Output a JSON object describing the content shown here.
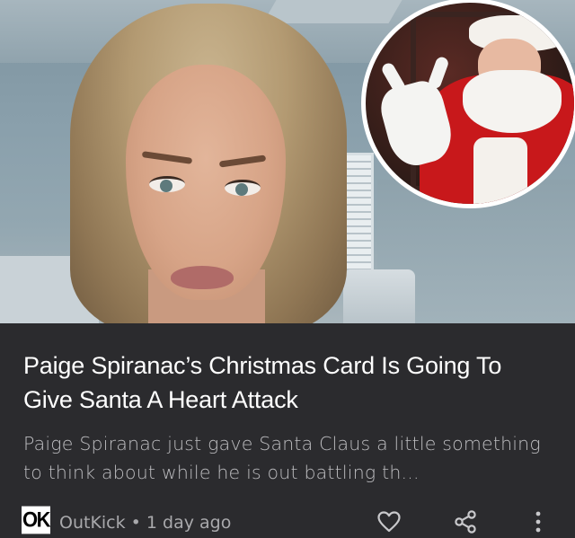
{
  "article": {
    "headline": "Paige Spiranac’s Christmas Card Is Going To Give Santa A Heart Attack",
    "snippet": "Paige Spiranac just gave Santa Claus a little something to think about while he is out battling th...",
    "source_logo": "OK",
    "source_line": "OutKick • 1 day ago"
  },
  "icons": {
    "like": "heart-icon",
    "share": "share-icon",
    "more": "more-vert-icon"
  },
  "colors": {
    "background": "#2b2b2e",
    "headline": "#ffffff",
    "snippet": "#bdbdc0",
    "meta": "#a9a9ac",
    "icon": "#c9c9cc"
  }
}
